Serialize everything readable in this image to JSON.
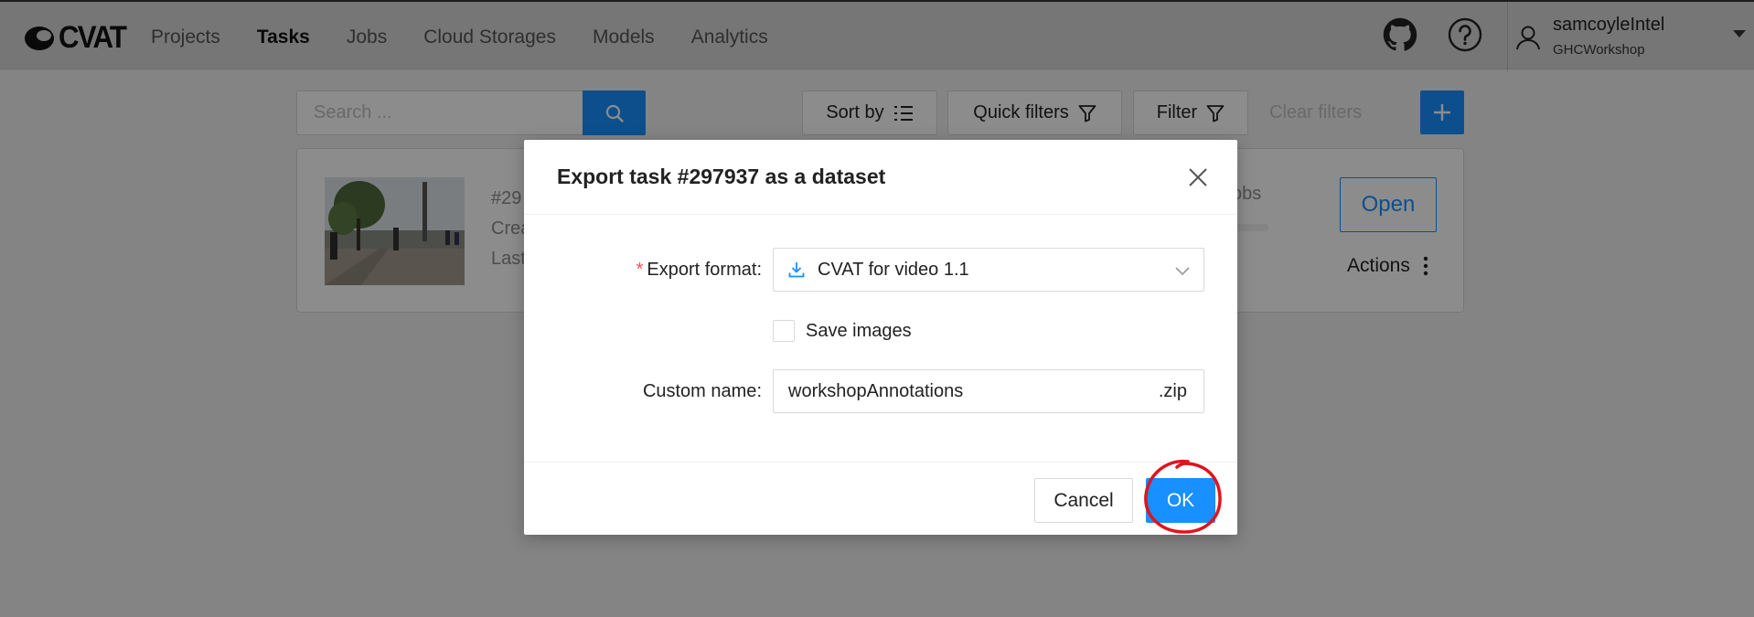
{
  "header": {
    "logo_text": "CVAT",
    "nav": [
      "Projects",
      "Tasks",
      "Jobs",
      "Cloud Storages",
      "Models",
      "Analytics"
    ],
    "active_nav": "Tasks",
    "user": {
      "name": "samcoyleIntel",
      "org": "GHCWorkshop"
    }
  },
  "toolbar": {
    "search_placeholder": "Search ...",
    "sort_label": "Sort by",
    "quick_filters_label": "Quick filters",
    "filter_label": "Filter",
    "clear_filters_label": "Clear filters"
  },
  "task_card": {
    "id_partial": "#29",
    "created_partial": "Crea",
    "last_partial": "Last",
    "jobs_partial": "obs",
    "open_label": "Open",
    "actions_label": "Actions"
  },
  "modal": {
    "title": "Export task #297937 as a dataset",
    "format_label": "Export format",
    "format_value": "CVAT for video 1.1",
    "save_images_label": "Save images",
    "save_images_checked": false,
    "custom_name_label": "Custom name",
    "custom_name_value": "workshopAnnotations",
    "custom_name_suffix": ".zip",
    "cancel_label": "Cancel",
    "ok_label": "OK"
  },
  "colors": {
    "primary": "#1890ff",
    "annotation_circle": "#e0141e",
    "required_mark": "#ff4d4f"
  }
}
